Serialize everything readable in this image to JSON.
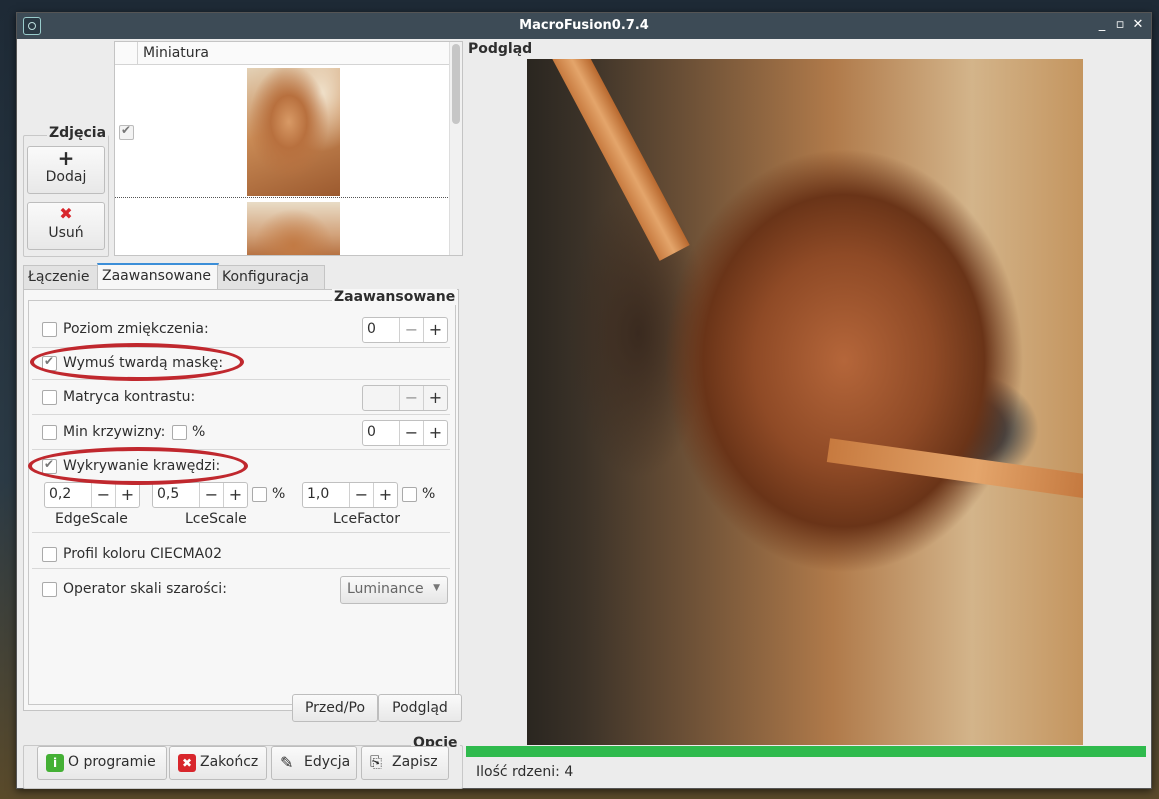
{
  "window": {
    "title": "MacroFusion0.7.4"
  },
  "photos": {
    "legend": "Zdjęcia",
    "add_label": "Dodaj",
    "remove_label": "Usuń",
    "column_header": "Miniatura"
  },
  "tabs": [
    "Łączenie",
    "Zaawansowane",
    "Konfiguracja"
  ],
  "advanced": {
    "legend": "Zaawansowane",
    "soften_label": "Poziom zmiękczenia:",
    "soften_value": "0",
    "hardmask_label": "Wymuś twardą maskę:",
    "contrast_label": "Matryca kontrastu:",
    "contrast_value": "",
    "curvature_label": "Min krzywizny:",
    "curvature_percent": "%",
    "curvature_value": "0",
    "edge_label": "Wykrywanie krawędzi:",
    "edge_scale_value": "0,2",
    "lce_scale_value": "0,5",
    "lce_scale_percent": "%",
    "lce_factor_value": "1,0",
    "lce_factor_percent": "%",
    "edge_scale_caption": "EdgeScale",
    "lce_scale_caption": "LceScale",
    "lce_factor_caption": "LceFactor",
    "color_profile_label": "Profil koloru CIECMA02",
    "grayscale_label": "Operator skali szarości:",
    "grayscale_option": "Luminance"
  },
  "buttons": {
    "before_after": "Przed/Po",
    "preview": "Podgląd"
  },
  "options": {
    "legend": "Opcje",
    "about": "O programie",
    "quit": "Zakończ",
    "edit": "Edycja",
    "save": "Zapisz"
  },
  "preview": {
    "title": "Podgląd",
    "progress": 1.0,
    "cores_label": "Ilość rdzeni: 4"
  },
  "colors": {
    "accent_tab": "#3b8ed8",
    "progress": "#2fba4d",
    "highlight": "#c0282e"
  }
}
